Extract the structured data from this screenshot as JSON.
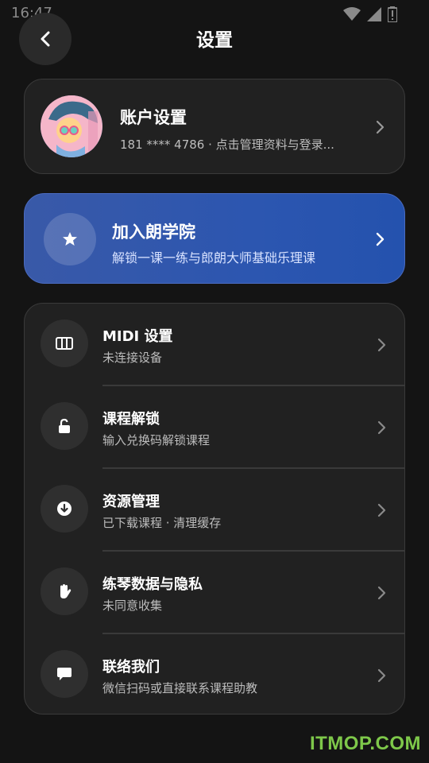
{
  "status_bar": {
    "time": "16:47"
  },
  "header": {
    "title": "设置"
  },
  "account": {
    "title": "账户设置",
    "subtitle": "181 **** 4786 · 点击管理资料与登录..."
  },
  "promo": {
    "title": "加入朗学院",
    "subtitle": "解锁一课一练与郎朗大师基础乐理课"
  },
  "menu": {
    "items": [
      {
        "title": "MIDI 设置",
        "subtitle": "未连接设备",
        "icon": "piano-keys-icon"
      },
      {
        "title": "课程解锁",
        "subtitle": "输入兑换码解锁课程",
        "icon": "lock-icon"
      },
      {
        "title": "资源管理",
        "subtitle": "已下载课程 · 清理缓存",
        "icon": "download-icon"
      },
      {
        "title": "练琴数据与隐私",
        "subtitle": "未同意收集",
        "icon": "hand-icon"
      },
      {
        "title": "联络我们",
        "subtitle": "微信扫码或直接联系课程助教",
        "icon": "chat-bubble-icon"
      }
    ]
  },
  "watermark": "ITMOP.COM",
  "colors": {
    "background": "#141414",
    "card": "#212121",
    "promo": "#2c56b0",
    "watermark": "#7ec84a"
  }
}
